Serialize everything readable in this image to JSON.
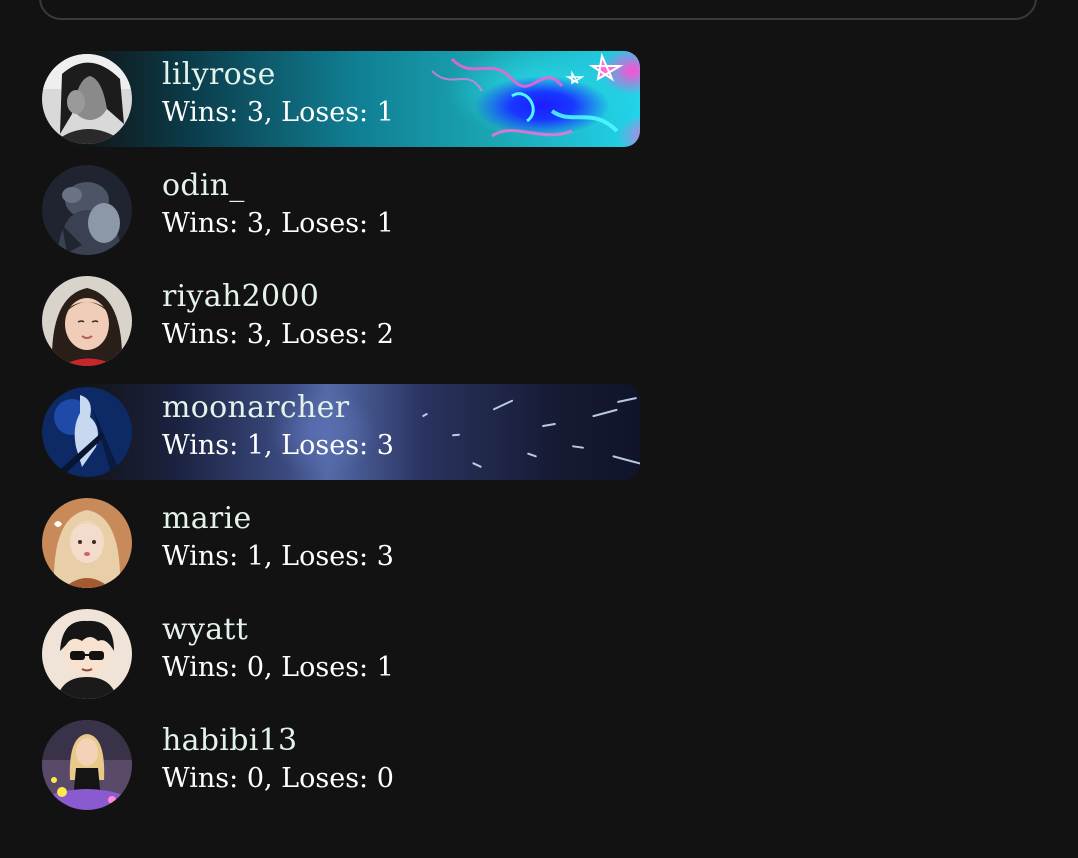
{
  "leaderboard": {
    "players": [
      {
        "username": "lilyrose",
        "record": "Wins: 3, Loses: 1",
        "wins": 3,
        "loses": 1,
        "banner": "neon-graffiti"
      },
      {
        "username": "odin_",
        "record": "Wins: 3, Loses: 1",
        "wins": 3,
        "loses": 1,
        "banner": "none"
      },
      {
        "username": "riyah2000",
        "record": "Wins: 3, Loses: 2",
        "wins": 3,
        "loses": 2,
        "banner": "none"
      },
      {
        "username": "moonarcher",
        "record": "Wins: 1, Loses: 3",
        "wins": 1,
        "loses": 3,
        "banner": "hyperspace"
      },
      {
        "username": "marie",
        "record": "Wins: 1, Loses: 3",
        "wins": 1,
        "loses": 3,
        "banner": "none"
      },
      {
        "username": "wyatt",
        "record": "Wins: 0, Loses: 1",
        "wins": 0,
        "loses": 1,
        "banner": "none"
      },
      {
        "username": "habibi13",
        "record": "Wins: 0, Loses: 0",
        "wins": 0,
        "loses": 0,
        "banner": "none"
      }
    ]
  },
  "colors": {
    "background": "#121212",
    "username_text": "#e4f3ea",
    "stats_text": "#ffffff",
    "panel_border": "#3a3a3a"
  }
}
